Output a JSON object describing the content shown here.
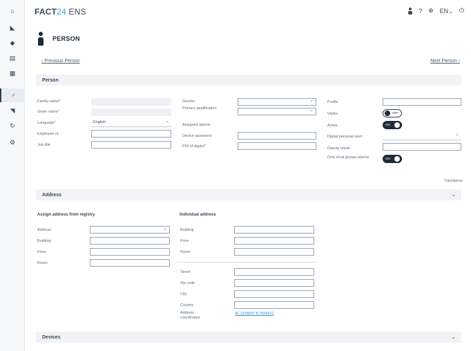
{
  "app": {
    "brand_name": "FACT",
    "brand_number": "24",
    "brand_suffix": "ENS"
  },
  "rail": {
    "items": [
      {
        "name": "rail-home-icon",
        "glyph": "⌂"
      },
      {
        "name": "rail-alarm-icon",
        "glyph": "◣"
      },
      {
        "name": "rail-broadcast-icon",
        "glyph": "◆"
      },
      {
        "name": "rail-document-icon",
        "glyph": "▤"
      },
      {
        "name": "rail-list-icon",
        "glyph": "▦"
      },
      {
        "name": "rail-persons-icon",
        "glyph": "♂",
        "active": true
      },
      {
        "name": "rail-location-icon",
        "glyph": "◥"
      },
      {
        "name": "rail-sync-icon",
        "glyph": "↻"
      },
      {
        "name": "rail-settings-icon",
        "glyph": "⚙"
      }
    ]
  },
  "topbar": {
    "question_glyph": "?",
    "globe_glyph": "⊕",
    "language": "EN",
    "language_caret": "⌄",
    "logout_glyph": "⏻"
  },
  "page": {
    "title": "PERSON",
    "prev_label": "‹  Previous Person",
    "next_label": "Next Person  ›"
  },
  "person": {
    "section_label": "Person",
    "family_name_label": "Family name*",
    "given_name_label": "Given name*",
    "language_label": "Language*",
    "language_value": "English",
    "employee_no_label": "Employee nr.",
    "job_title_label": "Job title",
    "gender_label": "Gender",
    "primary_qualification_label": "Primary qualification",
    "assigned_alarms_label": "Assigned alarms",
    "device_password_label": "Device password",
    "pin_label": "PIN (4 digits)*",
    "profile_label": "Profile",
    "visitor_label": "Visitor",
    "visitor_toggle_text": "OFF",
    "active_label": "Active",
    "active_toggle_text": "ON",
    "digital_personal_alert_label": "Digital personal alert",
    "deputy_email_label": "Deputy email",
    "only_local_groups_label": "Only local groups alarms",
    "only_local_groups_toggle_text": "ON",
    "translations_label": "Translations"
  },
  "address": {
    "section_label": "Address",
    "registry_heading": "Assign address from registry",
    "registry_address_label": "Address",
    "registry_building_label": "Building",
    "registry_floor_label": "Floor",
    "registry_room_label": "Room",
    "individual_heading": "Individual address",
    "ind_building_label": "Building",
    "ind_floor_label": "Floor",
    "ind_room_label": "Room",
    "street_label": "Street",
    "zip_label": "Zip code",
    "city_label": "City",
    "country_label": "Country",
    "coordinates_label": "Address coordinates",
    "coordinates_link": "41.1234567 8.7654321",
    "section_chevron": "⌄"
  },
  "devices": {
    "section_label": "Devices",
    "section_chevron": "⌄"
  }
}
